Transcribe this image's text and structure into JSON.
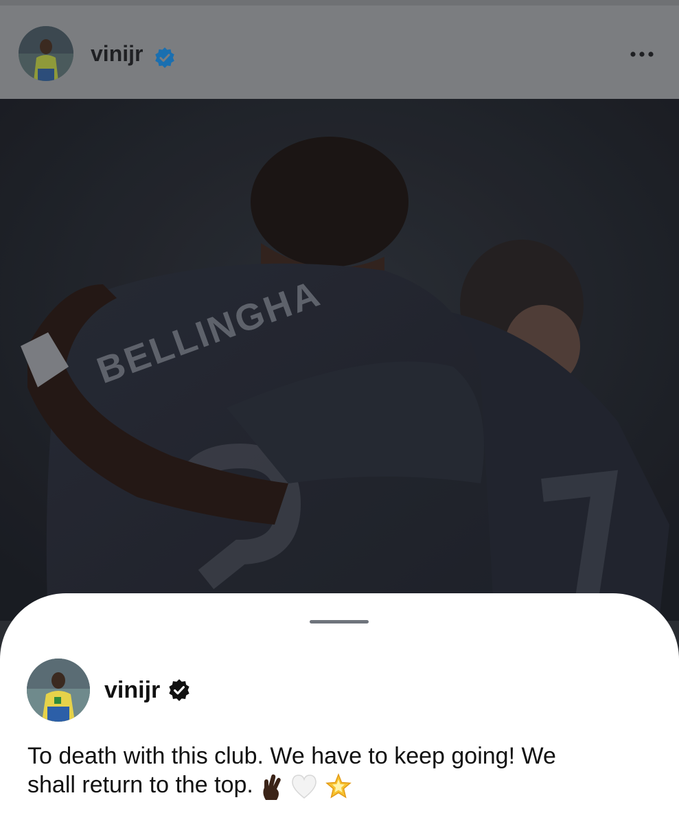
{
  "post": {
    "username": "vinijr",
    "avatar_icon": "player-avatar",
    "verified_icon": "verified-badge-icon",
    "more_icon": "more-options-icon",
    "photo_jersey_text": "BELLINGHA"
  },
  "sheet": {
    "username": "vinijr",
    "verified_icon": "verified-badge-icon",
    "caption_line1": "To death with this club. We have to keep going! We",
    "caption_line2": "shall return to the top.",
    "caption_emojis": [
      "crossed-fingers-icon",
      "white-heart-icon",
      "glowing-star-icon"
    ]
  },
  "colors": {
    "verified_blue": "#1d8fe0",
    "verified_black": "#111111",
    "sheet_bg": "#ffffff"
  }
}
